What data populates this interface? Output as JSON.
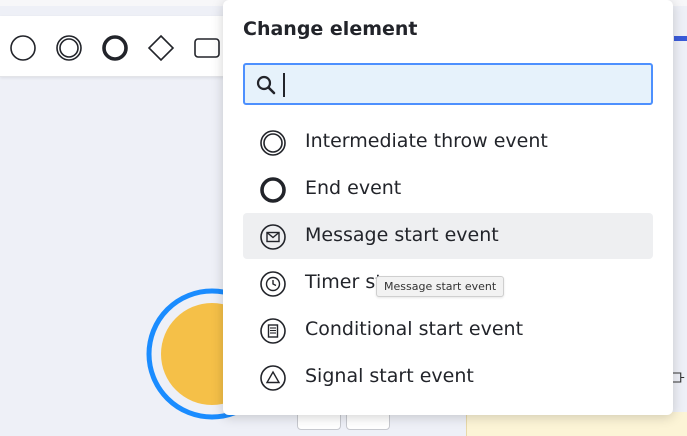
{
  "palette": {
    "icons": [
      "start-event-icon",
      "intermediate-event-icon",
      "end-event-icon",
      "gateway-icon",
      "task-icon"
    ]
  },
  "popup": {
    "title": "Change element",
    "search": {
      "value": "",
      "placeholder": ""
    },
    "items": [
      {
        "label": "Intermediate throw event",
        "icon": "intermediate-throw-event-icon"
      },
      {
        "label": "End event",
        "icon": "end-event-icon"
      },
      {
        "label": "Message start event",
        "icon": "message-start-event-icon"
      },
      {
        "label": "Timer st",
        "icon": "timer-start-event-icon"
      },
      {
        "label": "Conditional start event",
        "icon": "conditional-start-event-icon"
      },
      {
        "label": "Signal start event",
        "icon": "signal-start-event-icon"
      }
    ],
    "tooltip": "Message start event"
  },
  "colors": {
    "accent": "#4d90fe",
    "selection": "#1a8cff",
    "event_fill": "#f5c048",
    "hover": "#eeeff1"
  }
}
